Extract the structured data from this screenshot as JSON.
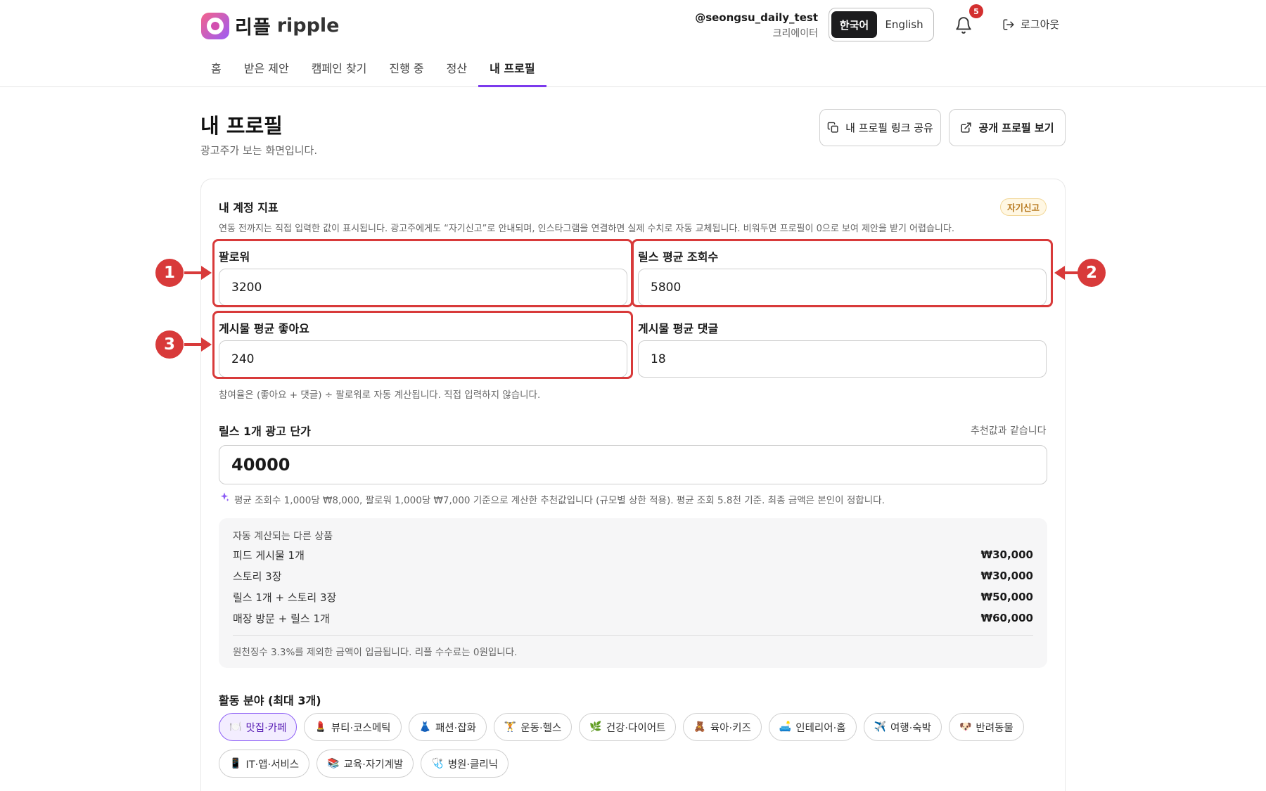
{
  "header": {
    "logo_ko": "리플",
    "logo_en": "ripple",
    "user_handle": "@seongsu_daily_test",
    "user_role": "크리에이터",
    "lang_ko": "한국어",
    "lang_en": "English",
    "notification_count": "5",
    "logout_label": "로그아웃",
    "nav": [
      "홈",
      "받은 제안",
      "캠페인 찾기",
      "진행 중",
      "정산",
      "내 프로필"
    ],
    "active_nav": "내 프로필"
  },
  "page": {
    "title": "내 프로필",
    "subtitle": "광고주가 보는 화면입니다.",
    "share_button": "내 프로필 링크 공유",
    "public_button": "공개 프로필 보기"
  },
  "metrics": {
    "title": "내 계정 지표",
    "badge": "자기신고",
    "note": "연동 전까지는 직접 입력한 값이 표시됩니다. 광고주에게도 “자기신고”로 안내되며, 인스타그램을 연결하면 실제 수치로 자동 교체됩니다. 비워두면 프로필이 0으로 보여 제안을 받기 어렵습니다.",
    "followers_label": "팔로워",
    "followers_value": "3200",
    "reels_views_label": "릴스 평균 조회수",
    "reels_views_value": "5800",
    "likes_label": "게시물 평균 좋아요",
    "likes_value": "240",
    "comments_label": "게시물 평균 댓글",
    "comments_value": "18",
    "engagement_note": "참여율은 (좋아요 + 댓글) ÷ 팔로워로 자동 계산됩니다. 직접 입력하지 않습니다."
  },
  "annotations": [
    "1",
    "2",
    "3"
  ],
  "pricing": {
    "label": "릴스 1개 광고 단가",
    "hint": "추천값과 같습니다",
    "value": "40000",
    "recommend_note": "평균 조회수 1,000당 ₩8,000, 팔로워 1,000당 ₩7,000 기준으로 계산한 추천값입니다 (규모별 상한 적용). 평균 조회 5.8천 기준. 최종 금액은 본인이 정합니다."
  },
  "products": {
    "title": "자동 계산되는 다른 상품",
    "items": [
      {
        "name": "피드 게시물 1개",
        "price": "₩30,000"
      },
      {
        "name": "스토리 3장",
        "price": "₩30,000"
      },
      {
        "name": "릴스 1개 + 스토리 3장",
        "price": "₩50,000"
      },
      {
        "name": "매장 방문 + 릴스 1개",
        "price": "₩60,000"
      }
    ],
    "footnote": "원천징수 3.3%를 제외한 금액이 입금됩니다. 리플 수수료는 0원입니다."
  },
  "categories": {
    "title": "활동 분야 (최대 3개)",
    "items": [
      {
        "emoji": "🍽️",
        "label": "맛집·카페",
        "selected": true
      },
      {
        "emoji": "💄",
        "label": "뷰티·코스메틱",
        "selected": false
      },
      {
        "emoji": "👗",
        "label": "패션·잡화",
        "selected": false
      },
      {
        "emoji": "🏋️",
        "label": "운동·헬스",
        "selected": false
      },
      {
        "emoji": "🌿",
        "label": "건강·다이어트",
        "selected": false
      },
      {
        "emoji": "🧸",
        "label": "육아·키즈",
        "selected": false
      },
      {
        "emoji": "🛋️",
        "label": "인테리어·홈",
        "selected": false
      },
      {
        "emoji": "✈️",
        "label": "여행·숙박",
        "selected": false
      },
      {
        "emoji": "🐶",
        "label": "반려동물",
        "selected": false
      },
      {
        "emoji": "📱",
        "label": "IT·앱·서비스",
        "selected": false
      },
      {
        "emoji": "📚",
        "label": "교육·자기계발",
        "selected": false
      },
      {
        "emoji": "🩺",
        "label": "병원·클리닉",
        "selected": false
      }
    ]
  },
  "colors": {
    "accent": "#7c3aed",
    "annotation_red": "#d83a3a",
    "badge_bg": "#fff7e3",
    "dark": "#1c1c1e"
  }
}
